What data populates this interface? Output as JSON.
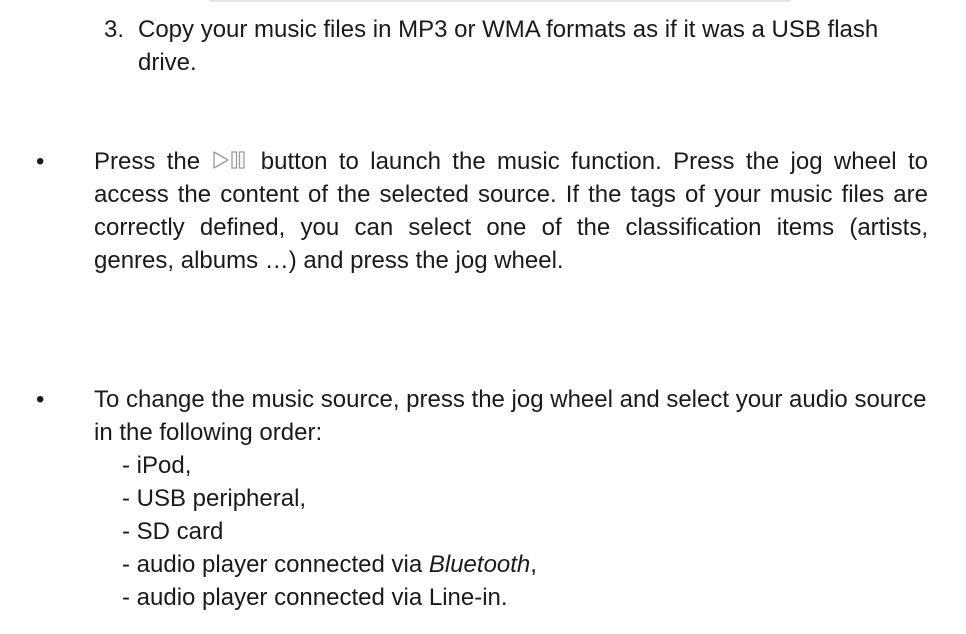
{
  "step3": {
    "number": "3.",
    "text": "Copy your music files in MP3 or WMA formats as if it was a USB flash drive."
  },
  "bullet1": {
    "symbol": "•",
    "text_before_icon": "Press the",
    "icon": "play-pause-icon",
    "text_after_icon": " button to launch the music function. Press the jog wheel to access the content of the selected source. If the tags of your music files are correctly defined, you can select one of the classification items (artists, genres, albums …) and press the jog wheel."
  },
  "bullet2": {
    "symbol": "•",
    "intro": "To change the music source, press the jog wheel and select your audio source in the following order:",
    "items": [
      {
        "text": "- iPod,"
      },
      {
        "text": "- USB peripheral,"
      },
      {
        "text": "- SD card"
      },
      {
        "text_before": "- audio player connected via ",
        "emphasis": "Bluetooth",
        "text_after": ","
      },
      {
        "text": "- audio player connected via Line-in."
      }
    ]
  },
  "colors": {
    "text": "#1a1a1a",
    "rule": "#e6e6e6"
  }
}
